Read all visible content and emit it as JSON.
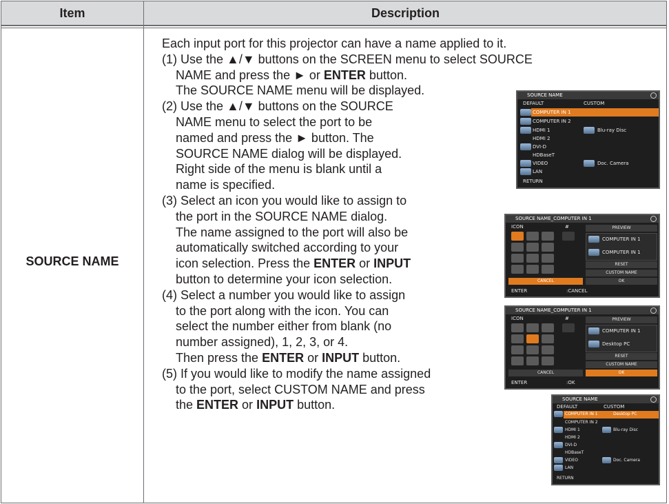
{
  "table": {
    "header_item": "Item",
    "header_description": "Description",
    "item_name": "SOURCE NAME"
  },
  "description": {
    "intro": "Each input port for this projector can have a name applied to it.",
    "step1_a": "(1) Use the ▲/▼ buttons on the SCREEN menu to select SOURCE",
    "step1_b_pre": "NAME and press the ► or ",
    "step1_b_bold": "ENTER",
    "step1_b_post": " button.",
    "step1_c": "The SOURCE NAME menu will be displayed.",
    "step2_a": "(2) Use the ▲/▼ buttons on the SOURCE",
    "step2_b": "NAME menu to select the port to be",
    "step2_c": "named and press the ► button. The",
    "step2_d": "SOURCE NAME dialog will be displayed.",
    "step2_e": "Right side of the menu is blank until a",
    "step2_f": "name is specified.",
    "step3_a": "(3) Select an icon you would like to assign to",
    "step3_b": "the port in the SOURCE NAME dialog.",
    "step3_c": "The name assigned to the port will also be",
    "step3_d": "automatically switched according to your",
    "step3_e_pre": "icon selection. Press the ",
    "step3_e_bold1": "ENTER",
    "step3_e_mid": " or ",
    "step3_e_bold2": "INPUT",
    "step3_f": "button to determine your icon selection.",
    "step4_a": "(4) Select a number you would like to assign",
    "step4_b": "to the port along with the icon. You can",
    "step4_c": "select the number either from blank (no",
    "step4_d": "number assigned), 1, 2, 3, or 4.",
    "step4_e_pre": "Then press the ",
    "step4_e_bold1": "ENTER",
    "step4_e_mid": " or ",
    "step4_e_bold2": "INPUT",
    "step4_e_post": " button.",
    "step5_a": "(5) If you would like to modify the name assigned",
    "step5_b": "to the port, select CUSTOM NAME and press",
    "step5_c_pre": "the ",
    "step5_c_bold1": "ENTER",
    "step5_c_mid": " or ",
    "step5_c_bold2": "INPUT",
    "step5_c_post": " button."
  },
  "osd_menu1": {
    "title": "SOURCE NAME",
    "col_default": "DEFAULT",
    "col_custom": "CUSTOM",
    "ports": [
      "COMPUTER IN 1",
      "COMPUTER IN 2",
      "HDMI 1",
      "HDMI 2",
      "DVI-D",
      "HDBaseT",
      "VIDEO",
      "LAN"
    ],
    "custom_hdmi1": "Blu-ray Disc",
    "custom_video": "Doc. Camera",
    "footer": "RETURN"
  },
  "osd_dialog1": {
    "title": "SOURCE NAME_COMPUTER IN 1",
    "col_icon": "ICON",
    "col_num": "#",
    "preview": "PREVIEW",
    "preview_name1": "COMPUTER IN 1",
    "preview_name2": "COMPUTER IN 1",
    "reset": "RESET",
    "custom_name": "CUSTOM NAME",
    "ok": "OK",
    "cancel": "CANCEL",
    "footer_left": "ENTER",
    "footer_right": ":CANCEL"
  },
  "osd_dialog2": {
    "title": "SOURCE NAME_COMPUTER IN 1",
    "col_icon": "ICON",
    "col_num": "#",
    "preview": "PREVIEW",
    "preview_name1": "COMPUTER IN 1",
    "preview_name2": "Desktop PC",
    "reset": "RESET",
    "custom_name": "CUSTOM NAME",
    "ok": "OK",
    "cancel": "CANCEL",
    "footer_left": "ENTER",
    "footer_right": ":OK"
  },
  "osd_menu2": {
    "title": "SOURCE NAME",
    "col_default": "DEFAULT",
    "col_custom": "CUSTOM",
    "ports": [
      "COMPUTER IN 1",
      "COMPUTER IN 2",
      "HDMI 1",
      "HDMI 2",
      "DVI-D",
      "HDBaseT",
      "VIDEO",
      "LAN"
    ],
    "custom_computer1": "Desktop PC",
    "custom_hdmi1": "Blu-ray Disc",
    "custom_video": "Doc. Camera",
    "footer": "RETURN"
  },
  "colors": {
    "header_bg": "#d9dadb",
    "border": "#6d6e71",
    "osd_bg": "#1e1e1e",
    "osd_highlight": "#e07b1f"
  }
}
